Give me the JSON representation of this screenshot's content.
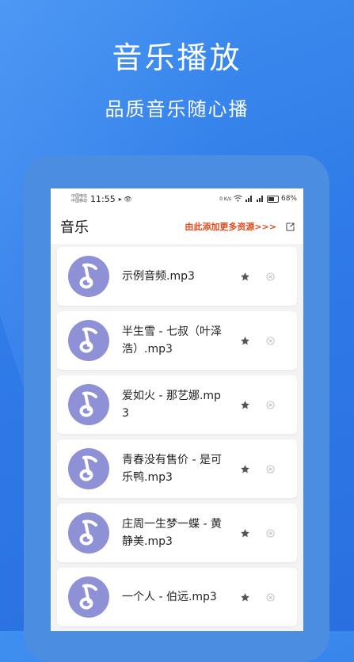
{
  "promo": {
    "headline": "音乐播放",
    "subline": "品质音乐随心播"
  },
  "status_bar": {
    "carrier_1": "中国电信",
    "carrier_2": "中国移动",
    "time": "11:55",
    "left_icons": "▸ 👁",
    "net_speed": "0 K/s",
    "battery_percent": "68%"
  },
  "app_bar": {
    "title": "音乐",
    "add_link": "由此添加更多资源>>>"
  },
  "songs": [
    {
      "name": "示例音频.mp3"
    },
    {
      "name": "半生雪 - 七叔（叶泽浩）.mp3"
    },
    {
      "name": "爱如火 - 那艺娜.mp3"
    },
    {
      "name": "青春没有售价 - 是可乐鸭.mp3"
    },
    {
      "name": "庄周一生梦一蝶 - 黄静美.mp3"
    },
    {
      "name": "一个人 - 伯远.mp3"
    }
  ],
  "icons": {
    "song_icon": "music-note-icon",
    "favorite": "star-icon",
    "remove": "close-circle-icon",
    "external": "external-link-icon"
  },
  "colors": {
    "background": "#2f7be8",
    "phone_frame": "#4b8de0",
    "note_circle": "#8f91d6",
    "link": "#e8481a"
  }
}
